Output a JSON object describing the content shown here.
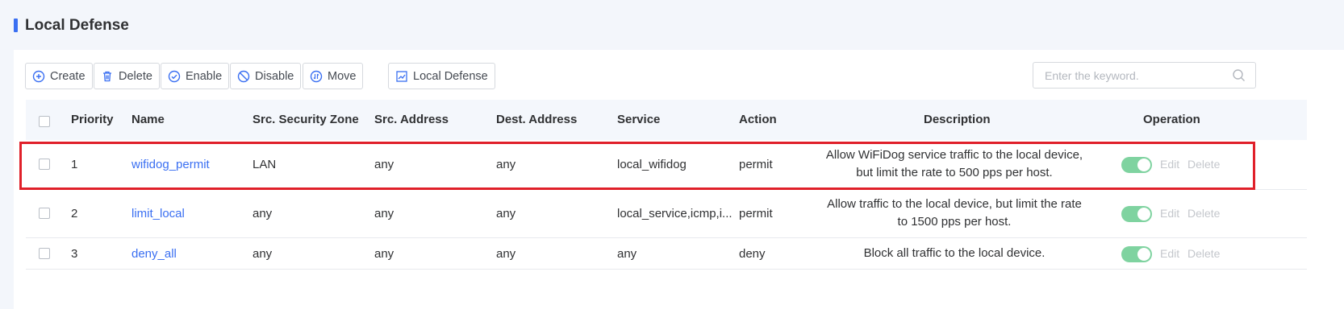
{
  "page": {
    "title": "Local Defense"
  },
  "toolbar": {
    "create": "Create",
    "delete": "Delete",
    "enable": "Enable",
    "disable": "Disable",
    "move": "Move",
    "local_defense": "Local Defense"
  },
  "search": {
    "placeholder": "Enter the keyword."
  },
  "table": {
    "headers": {
      "priority": "Priority",
      "name": "Name",
      "src_zone": "Src. Security Zone",
      "src_address": "Src. Address",
      "dest_address": "Dest. Address",
      "service": "Service",
      "action": "Action",
      "description": "Description",
      "operation": "Operation"
    },
    "rows": [
      {
        "priority": "1",
        "name": "wifidog_permit",
        "src_zone": "LAN",
        "src_address": "any",
        "dest_address": "any",
        "service": "local_wifidog",
        "action": "permit",
        "description": "Allow WiFiDog service traffic to the local device, but limit the rate to 500 pps per host.",
        "enabled": true,
        "edit": "Edit",
        "delete": "Delete"
      },
      {
        "priority": "2",
        "name": "limit_local",
        "src_zone": "any",
        "src_address": "any",
        "dest_address": "any",
        "service": "local_service,icmp,i...",
        "action": "permit",
        "description": "Allow traffic to the local device, but limit the rate to 1500 pps per host.",
        "enabled": true,
        "edit": "Edit",
        "delete": "Delete"
      },
      {
        "priority": "3",
        "name": "deny_all",
        "src_zone": "any",
        "src_address": "any",
        "dest_address": "any",
        "service": "any",
        "action": "deny",
        "description": "Block all traffic to the local device.",
        "enabled": true,
        "edit": "Edit",
        "delete": "Delete"
      }
    ]
  },
  "colors": {
    "accent": "#3a6ff2",
    "toggle_on": "#7fd3a0",
    "highlight": "#e0202a"
  }
}
